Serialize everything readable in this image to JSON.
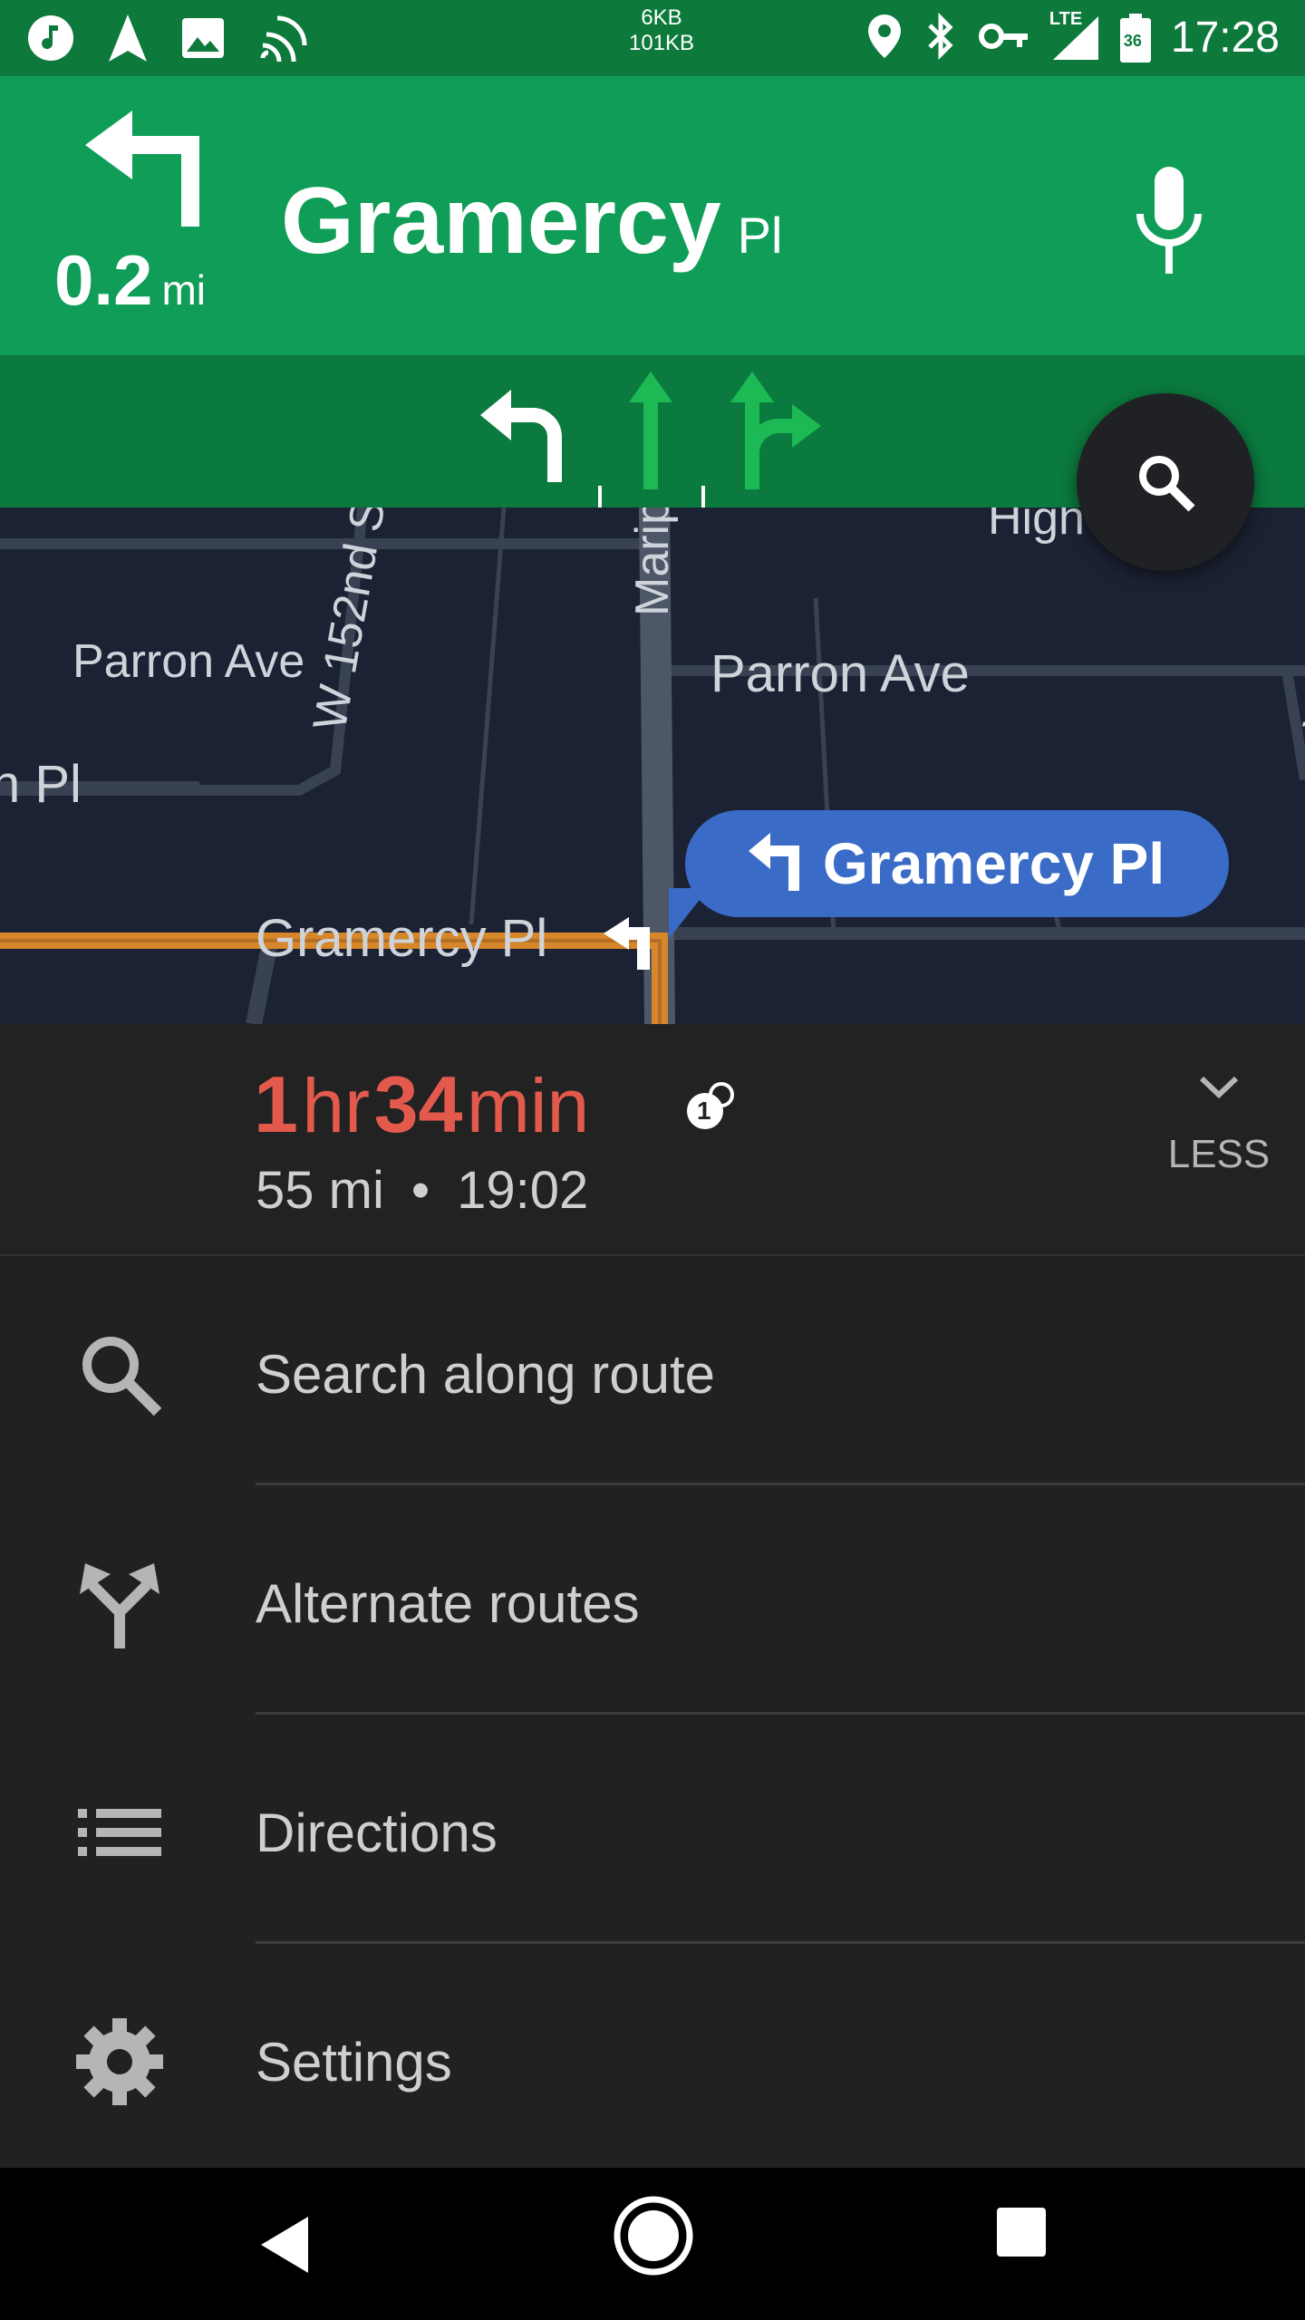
{
  "status_bar": {
    "net_up": "6KB",
    "net_down": "101KB",
    "lte": "LTE",
    "battery": "36",
    "time": "17:28",
    "icons": [
      "music-icon",
      "navigation-icon",
      "image-icon",
      "cast-icon",
      "location-icon",
      "bluetooth-icon",
      "vpn-key-icon",
      "signal-icon",
      "battery-icon"
    ]
  },
  "nav": {
    "distance_value": "0.2",
    "distance_unit": "mi",
    "street_name": "Gramercy",
    "street_suffix": "Pl",
    "turn": "turn-left-icon"
  },
  "lanes": [
    "left",
    "straight",
    "straight-right"
  ],
  "map": {
    "labels": [
      "Parron Ave",
      "W 152nd S",
      "Marip",
      "Parron Ave",
      "n Pl",
      "Gramercy Pl",
      "High",
      "W"
    ],
    "callout_text": "Gramercy Pl"
  },
  "trip": {
    "eta_hr": "1",
    "eta_hr_label": "hr",
    "eta_min": "34",
    "eta_min_label": "min",
    "distance": "55 mi",
    "separator": "•",
    "arrival": "19:02",
    "less_label": "LESS",
    "traffic_badge": "1",
    "eta_color": "#e35a4d"
  },
  "menu": [
    {
      "label": "Search along route",
      "icon": "search-icon"
    },
    {
      "label": "Alternate routes",
      "icon": "alternate-routes-icon"
    },
    {
      "label": "Directions",
      "icon": "list-icon"
    },
    {
      "label": "Settings",
      "icon": "gear-icon"
    }
  ],
  "colors": {
    "header_green": "#0f9d58",
    "lane_green": "#0b7a3e",
    "route_orange": "#d8862a",
    "callout_blue": "#3a6bc6"
  }
}
